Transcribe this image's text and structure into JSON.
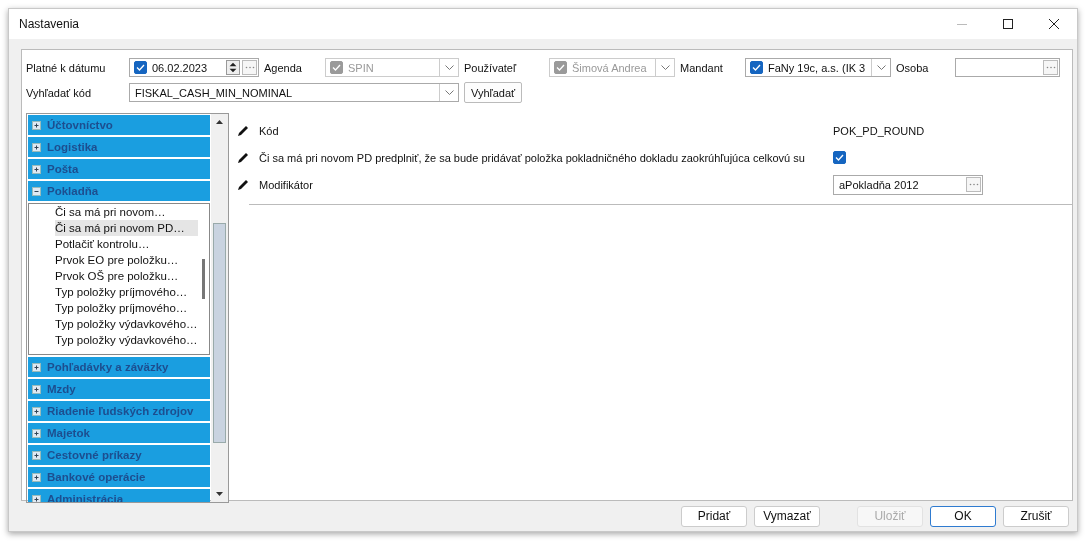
{
  "window": {
    "title": "Nastavenia"
  },
  "filters": {
    "date": {
      "label": "Platné k dátumu",
      "value": "06.02.2023",
      "checked": true
    },
    "agenda": {
      "label": "Agenda",
      "value": "SPIN",
      "checked": true,
      "disabled": true
    },
    "user": {
      "label": "Používateľ",
      "value": "Šimová Andrea",
      "checked": true,
      "disabled": true
    },
    "mandant": {
      "label": "Mandant",
      "value": "FaNy 19c, a.s. (IK 3",
      "checked": true,
      "disabled": false
    },
    "person": {
      "label": "Osoba"
    },
    "code_search": {
      "label": "Vyhľadať kód",
      "value": "FISKAL_CASH_MIN_NOMINAL",
      "button": "Vyhľadať"
    }
  },
  "categories": [
    {
      "label": "Účtovníctvo",
      "expanded": false
    },
    {
      "label": "Logistika",
      "expanded": false
    },
    {
      "label": "Pošta",
      "expanded": false
    },
    {
      "label": "Pokladňa",
      "expanded": true,
      "children": [
        {
          "label": "Či sa má pri novom…",
          "selected": false
        },
        {
          "label": "Či sa má pri novom PD…",
          "selected": true
        },
        {
          "label": "Potlačiť kontrolu…",
          "selected": false
        },
        {
          "label": "Prvok EO pre položku…",
          "selected": false
        },
        {
          "label": "Prvok OŠ pre položku…",
          "selected": false
        },
        {
          "label": "Typ položky príjmového…",
          "selected": false
        },
        {
          "label": "Typ položky príjmového…",
          "selected": false
        },
        {
          "label": "Typ položky výdavkového…",
          "selected": false
        },
        {
          "label": "Typ položky výdavkového…",
          "selected": false
        }
      ]
    },
    {
      "label": "Pohľadávky a záväzky",
      "expanded": false
    },
    {
      "label": "Mzdy",
      "expanded": false
    },
    {
      "label": "Riadenie ľudských zdrojov",
      "expanded": false
    },
    {
      "label": "Majetok",
      "expanded": false
    },
    {
      "label": "Cestovné príkazy",
      "expanded": false
    },
    {
      "label": "Bankové operácie",
      "expanded": false
    },
    {
      "label": "Administrácia",
      "expanded": false
    }
  ],
  "settings": [
    {
      "kind": "text",
      "label": "Kód",
      "value": "POK_PD_ROUND"
    },
    {
      "kind": "checkbox",
      "label": "Či sa má pri novom PD predplniť, že sa bude pridávať položka pokladničného dokladu zaokrúhľujúca celkovú su",
      "checked": true
    },
    {
      "kind": "picker",
      "label": "Modifikátor",
      "value": "aPokladňa 2012"
    }
  ],
  "buttons": [
    {
      "label": "Pridať",
      "disabled": false,
      "default": false
    },
    {
      "label": "Vymazať",
      "disabled": false,
      "default": false
    },
    {
      "label": "Uložiť",
      "disabled": true,
      "default": false
    },
    {
      "label": "OK",
      "disabled": false,
      "default": true
    },
    {
      "label": "Zrušiť",
      "disabled": false,
      "default": false
    }
  ]
}
